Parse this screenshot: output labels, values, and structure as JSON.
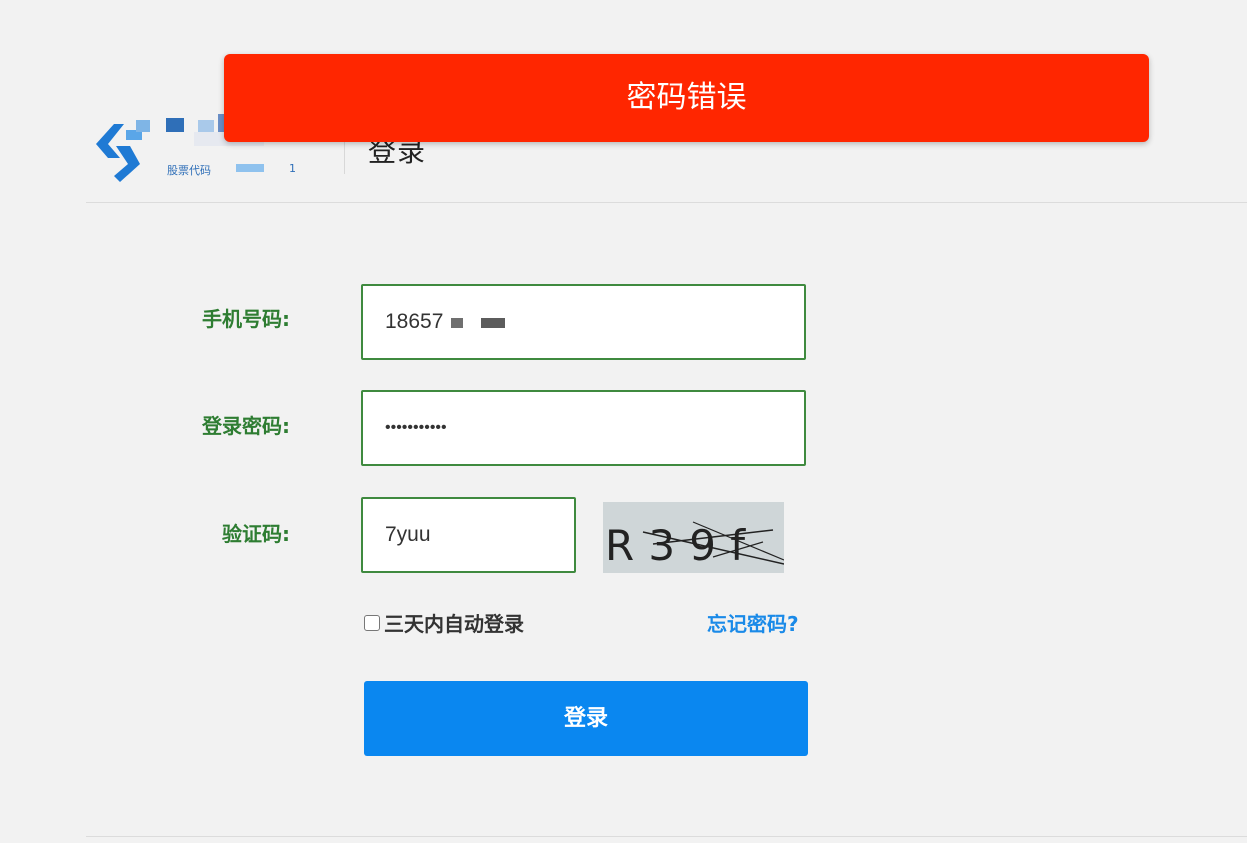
{
  "header": {
    "title": "登录",
    "logo_small_text": "股票代码",
    "logo_small_num": "1"
  },
  "toast": {
    "message": "密码错误"
  },
  "form": {
    "phone_label": "手机号码:",
    "phone_value": "18657",
    "password_label": "登录密码:",
    "password_value": "•••••••••••",
    "captcha_label": "验证码:",
    "captcha_value": "7yuu",
    "captcha_image_text": "R39f",
    "remember_label": "三天内自动登录",
    "forgot_link": "忘记密码?",
    "login_button": "登录"
  },
  "colors": {
    "toast": "#ff2600",
    "label": "#2e7d32",
    "field_border": "#3f8a3f",
    "primary_button": "#0a87f0",
    "link": "#1a8ae8"
  }
}
